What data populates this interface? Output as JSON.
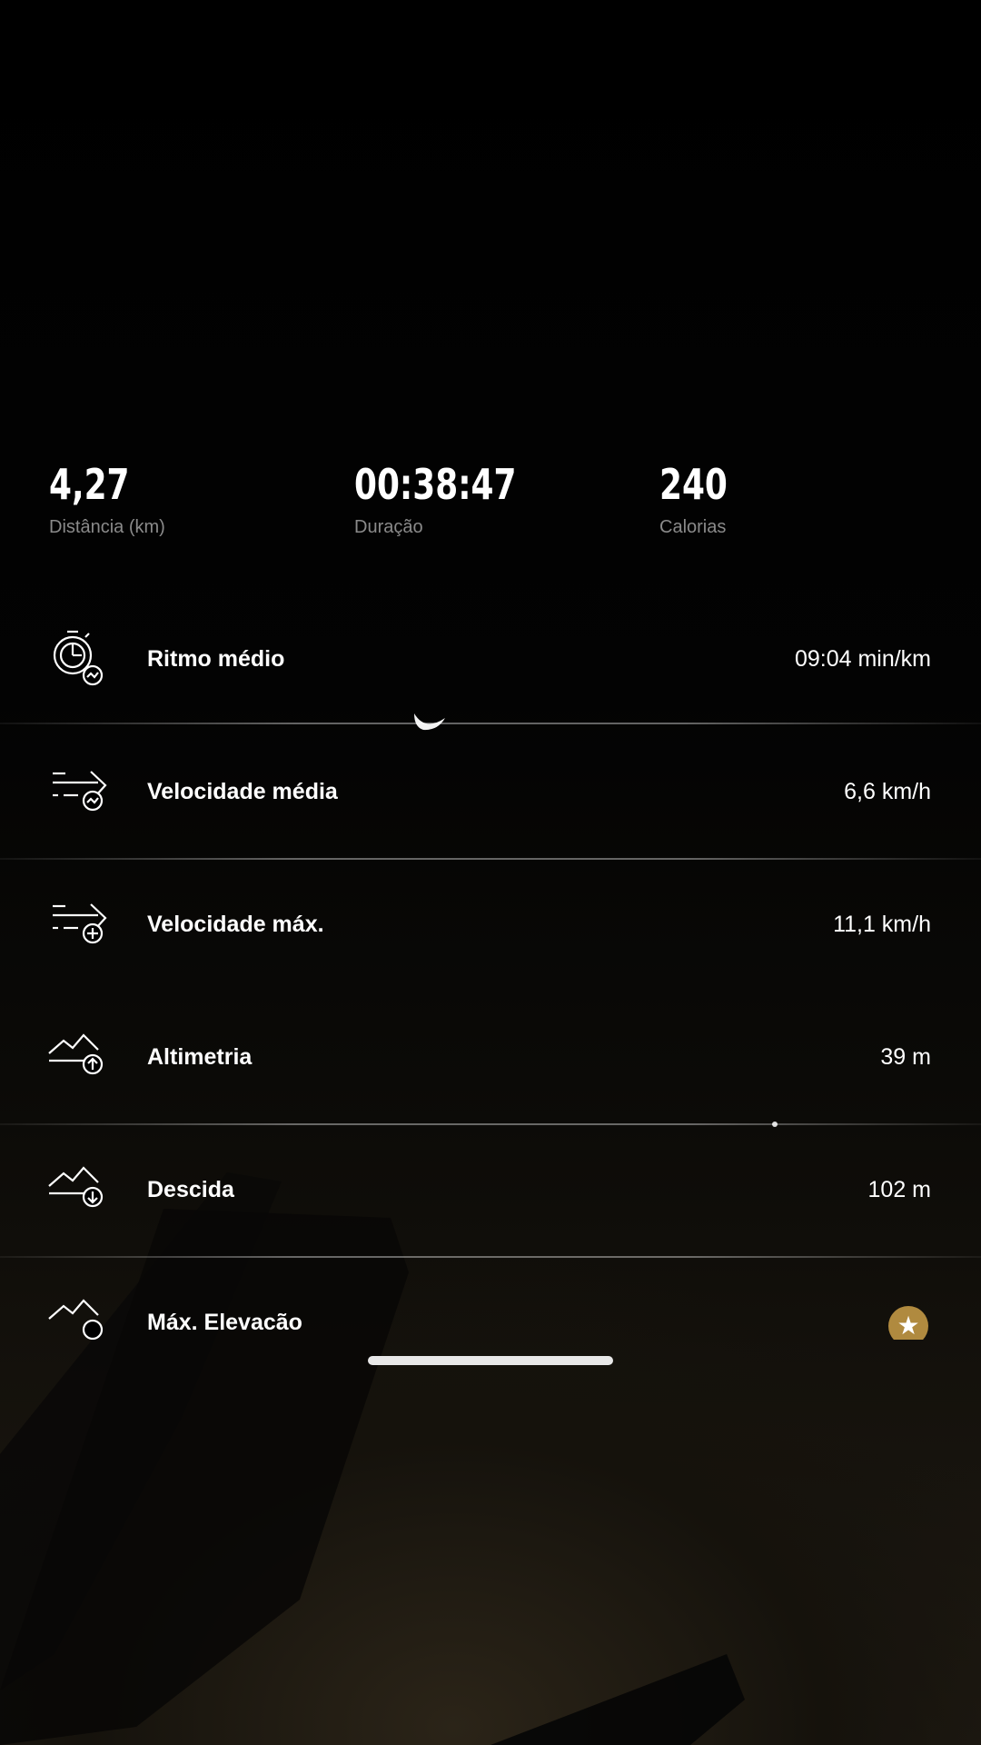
{
  "summary": {
    "distance": {
      "value": "4,27",
      "label": "Distância (km)"
    },
    "duration": {
      "value": "00:38:47",
      "label": "Duração"
    },
    "calories": {
      "value": "240",
      "label": "Calorias"
    }
  },
  "metrics": [
    {
      "name": "Ritmo médio",
      "value": "09:04 min/km",
      "icon": "stopwatch-pace-icon"
    },
    {
      "name": "Velocidade média",
      "value": "6,6 km/h",
      "icon": "speed-average-icon"
    },
    {
      "name": "Velocidade máx.",
      "value": "11,1 km/h",
      "icon": "speed-max-icon"
    },
    {
      "name": "Altimetria",
      "value": "39 m",
      "icon": "elevation-gain-icon"
    },
    {
      "name": "Descida",
      "value": "102 m",
      "icon": "elevation-loss-icon"
    },
    {
      "name": "Máx. Elevacão",
      "value": "",
      "icon": "max-elevation-icon",
      "badge": "star-badge-icon"
    }
  ],
  "colors": {
    "background": "#000000",
    "label_gray": "#8a8a8a",
    "badge_gold": "#b08a3f"
  }
}
